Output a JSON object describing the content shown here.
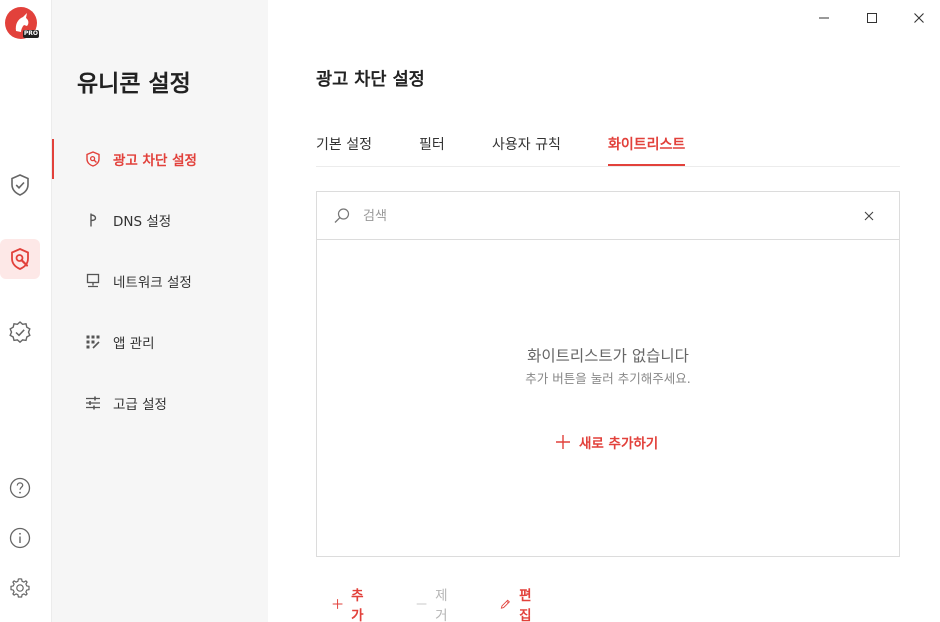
{
  "app": {
    "logo_badge": "PRO",
    "accent_color": "#e2413b"
  },
  "window": {
    "minimize_icon": "minimize-icon",
    "maximize_icon": "maximize-icon",
    "close_icon": "close-icon"
  },
  "rail": {
    "items": [
      {
        "name": "protection",
        "icon": "shield-check-icon"
      },
      {
        "name": "adblock",
        "icon": "shield-wrench-icon",
        "active": true
      },
      {
        "name": "badge",
        "icon": "badge-check-icon"
      },
      {
        "name": "help",
        "icon": "help-icon"
      },
      {
        "name": "info",
        "icon": "info-icon"
      },
      {
        "name": "settings",
        "icon": "gear-icon"
      }
    ]
  },
  "sidebar": {
    "title": "유니콘 설정",
    "items": [
      {
        "label": "광고 차단 설정",
        "icon": "shield-icon",
        "active": true
      },
      {
        "label": "DNS 설정",
        "icon": "dns-icon"
      },
      {
        "label": "네트워크 설정",
        "icon": "network-icon"
      },
      {
        "label": "앱 관리",
        "icon": "apps-icon"
      },
      {
        "label": "고급 설정",
        "icon": "sliders-icon"
      }
    ]
  },
  "main": {
    "title": "광고 차단 설정",
    "tabs": [
      {
        "label": "기본 설정"
      },
      {
        "label": "필터"
      },
      {
        "label": "사용자 규칙"
      },
      {
        "label": "화이트리스트",
        "active": true
      }
    ],
    "search": {
      "placeholder": "검색",
      "value": ""
    },
    "empty": {
      "title": "화이트리스트가 없습니다",
      "subtitle": "추가 버튼을 눌러 추기해주세요.",
      "add_new_label": "새로 추가하기"
    },
    "actions": {
      "add_label": "추가",
      "remove_label": "제거",
      "edit_label": "편집"
    }
  }
}
